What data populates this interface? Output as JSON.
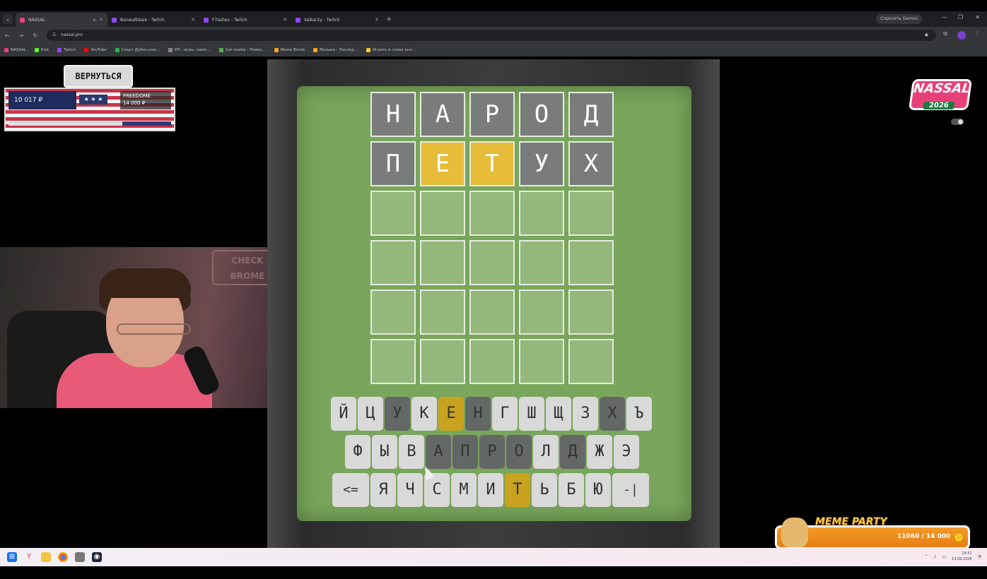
{
  "browser": {
    "tabs": [
      {
        "label": "NASSAL",
        "active": true
      },
      {
        "label": "Banwalkbaie - Twitch",
        "active": false
      },
      {
        "label": "F7ashev - Twitch",
        "active": false
      },
      {
        "label": "Valkar2y - Twitch",
        "active": false
      }
    ],
    "new_tab_symbol": "+",
    "gemini_label": "Спросить Gemini",
    "url": "nassal.pro",
    "bookmarks": [
      {
        "label": "NASSAL",
        "color": "#e8417a"
      },
      {
        "label": "Kick",
        "color": "#53fc18"
      },
      {
        "label": "Twitch",
        "color": "#9146ff"
      },
      {
        "label": "YouTube",
        "color": "#ff0000"
      },
      {
        "label": "Скорт Дубок.ком...",
        "color": "#1db954"
      },
      {
        "label": "ЕП - игры, комп...",
        "color": "#888888"
      },
      {
        "label": "Get media - Поиск...",
        "color": "#4caf50"
      },
      {
        "label": "Meme Bomb",
        "color": "#f5a623"
      },
      {
        "label": "Музыка - Послед...",
        "color": "#f5a623"
      },
      {
        "label": "Играть в слова онл...",
        "color": "#f6c627"
      }
    ]
  },
  "overlay": {
    "back_button": "ВЕРНУТЬСЯ",
    "balance": "10 017 ₽",
    "stars": "★ ★ ★",
    "freedom_label": "FREEDOME",
    "freedom_goal": "14 000 ₽",
    "freedom_progress": 0.7,
    "neon_sign": "CHECK BROME",
    "logo_line1": "NASSAL",
    "logo_line2": "2026",
    "meme_title": "MEME PARTY",
    "meme_progress": "11060 / 14 000",
    "meme_fill": 0.79
  },
  "game": {
    "rows": [
      [
        {
          "l": "Н",
          "s": "gray"
        },
        {
          "l": "А",
          "s": "gray"
        },
        {
          "l": "Р",
          "s": "gray"
        },
        {
          "l": "О",
          "s": "gray"
        },
        {
          "l": "Д",
          "s": "gray"
        }
      ],
      [
        {
          "l": "П",
          "s": "gray"
        },
        {
          "l": "Е",
          "s": "yellow"
        },
        {
          "l": "Т",
          "s": "yellow"
        },
        {
          "l": "У",
          "s": "gray"
        },
        {
          "l": "Х",
          "s": "gray"
        }
      ],
      [
        {
          "l": "",
          "s": "empty"
        },
        {
          "l": "",
          "s": "empty"
        },
        {
          "l": "",
          "s": "empty"
        },
        {
          "l": "",
          "s": "empty"
        },
        {
          "l": "",
          "s": "empty"
        }
      ],
      [
        {
          "l": "",
          "s": "empty"
        },
        {
          "l": "",
          "s": "empty"
        },
        {
          "l": "",
          "s": "empty"
        },
        {
          "l": "",
          "s": "empty"
        },
        {
          "l": "",
          "s": "empty"
        }
      ],
      [
        {
          "l": "",
          "s": "empty"
        },
        {
          "l": "",
          "s": "empty"
        },
        {
          "l": "",
          "s": "empty"
        },
        {
          "l": "",
          "s": "empty"
        },
        {
          "l": "",
          "s": "empty"
        }
      ],
      [
        {
          "l": "",
          "s": "empty"
        },
        {
          "l": "",
          "s": "empty"
        },
        {
          "l": "",
          "s": "empty"
        },
        {
          "l": "",
          "s": "empty"
        },
        {
          "l": "",
          "s": "empty"
        }
      ]
    ],
    "keyboard": [
      [
        {
          "k": "Й",
          "s": "normal"
        },
        {
          "k": "Ц",
          "s": "normal"
        },
        {
          "k": "У",
          "s": "gray"
        },
        {
          "k": "К",
          "s": "normal"
        },
        {
          "k": "Е",
          "s": "yellow"
        },
        {
          "k": "Н",
          "s": "gray"
        },
        {
          "k": "Г",
          "s": "normal"
        },
        {
          "k": "Ш",
          "s": "normal"
        },
        {
          "k": "Щ",
          "s": "normal"
        },
        {
          "k": "З",
          "s": "normal"
        },
        {
          "k": "Х",
          "s": "gray"
        },
        {
          "k": "Ъ",
          "s": "normal"
        }
      ],
      [
        {
          "k": "Ф",
          "s": "normal"
        },
        {
          "k": "Ы",
          "s": "normal"
        },
        {
          "k": "В",
          "s": "normal"
        },
        {
          "k": "А",
          "s": "gray"
        },
        {
          "k": "П",
          "s": "gray"
        },
        {
          "k": "Р",
          "s": "gray"
        },
        {
          "k": "О",
          "s": "gray"
        },
        {
          "k": "Л",
          "s": "normal"
        },
        {
          "k": "Д",
          "s": "gray"
        },
        {
          "k": "Ж",
          "s": "normal"
        },
        {
          "k": "Э",
          "s": "normal"
        }
      ],
      [
        {
          "k": "<=",
          "s": "normal"
        },
        {
          "k": "Я",
          "s": "normal"
        },
        {
          "k": "Ч",
          "s": "normal"
        },
        {
          "k": "С",
          "s": "normal"
        },
        {
          "k": "М",
          "s": "normal"
        },
        {
          "k": "И",
          "s": "normal"
        },
        {
          "k": "Т",
          "s": "yellow"
        },
        {
          "k": "Ь",
          "s": "normal"
        },
        {
          "k": "Б",
          "s": "normal"
        },
        {
          "k": "Ю",
          "s": "normal"
        },
        {
          "k": "-|",
          "s": "normal"
        }
      ]
    ]
  },
  "taskbar": {
    "clock_time": "18:51",
    "clock_date": "13.08.2026"
  }
}
